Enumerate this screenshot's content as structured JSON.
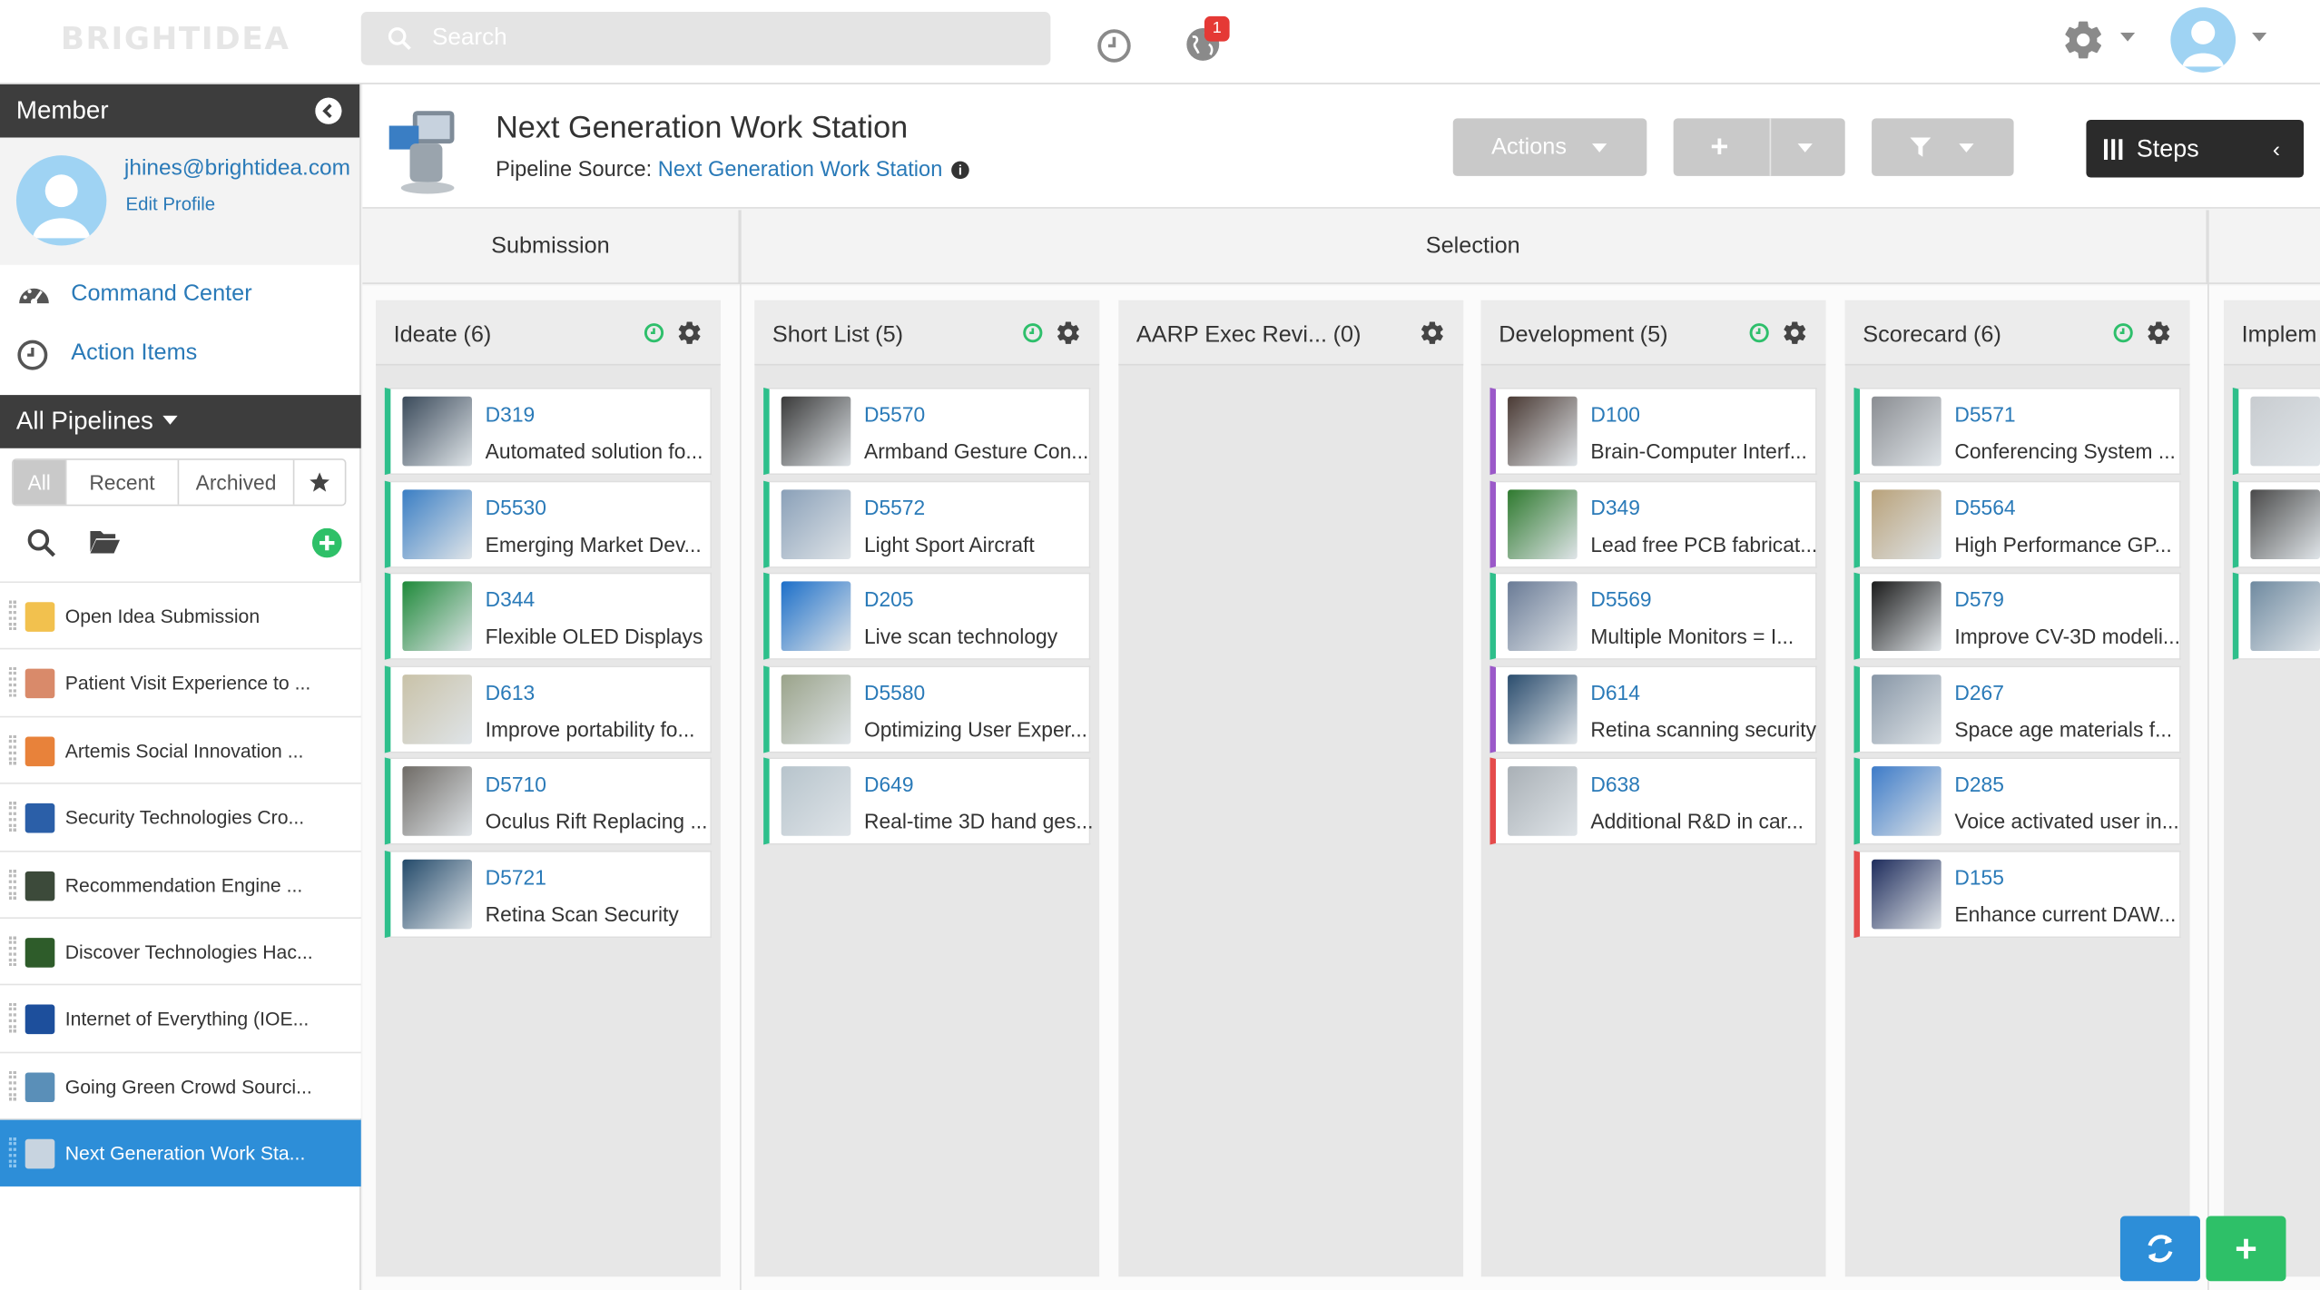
{
  "topbar": {
    "logo": "BRIGHTIDEA",
    "search_placeholder": "Search",
    "notification_count": "1"
  },
  "sidebar": {
    "member_title": "Member",
    "email": "jhines@brightidea.com",
    "edit_profile": "Edit Profile",
    "nav": [
      {
        "label": "Command Center",
        "icon": "dashboard-icon"
      },
      {
        "label": "Action Items",
        "icon": "clock-icon"
      }
    ],
    "pipelines_title": "All Pipelines",
    "filters": {
      "all": "All",
      "recent": "Recent",
      "archived": "Archived"
    },
    "pipelines": [
      {
        "label": "Open Idea Submission",
        "color": "#f2c14e"
      },
      {
        "label": "Patient Visit Experience to ...",
        "color": "#d98a6a"
      },
      {
        "label": "Artemis Social Innovation ...",
        "color": "#e8823a"
      },
      {
        "label": "Security Technologies Cro...",
        "color": "#2b5fa8"
      },
      {
        "label": "Recommendation Engine ...",
        "color": "#3c4a3a"
      },
      {
        "label": "Discover Technologies Hac...",
        "color": "#2e5c2a"
      },
      {
        "label": "Internet of Everything (IOE...",
        "color": "#1d4f9c"
      },
      {
        "label": "Going Green Crowd Sourci...",
        "color": "#5a8fb8"
      },
      {
        "label": "Next Generation Work Sta...",
        "color": "#c8d4e0",
        "active": true
      }
    ]
  },
  "header": {
    "title": "Next Generation Work Station",
    "source_label": "Pipeline Source: ",
    "source_link": "Next Generation Work Station",
    "actions_label": "Actions",
    "steps_label": "Steps"
  },
  "phases": {
    "submission": "Submission",
    "selection": "Selection"
  },
  "columns": [
    {
      "name": "Ideate",
      "count": "(6)",
      "clock": true,
      "cards": [
        {
          "id": "D319",
          "title": "Automated solution fo...",
          "color": "#2ebf8b",
          "img": "#3a4a5a"
        },
        {
          "id": "D5530",
          "title": "Emerging Market Dev...",
          "color": "#2ebf8b",
          "img": "#3a7ec4"
        },
        {
          "id": "D344",
          "title": "Flexible OLED Displays",
          "color": "#2ebf8b",
          "img": "#1f8a3a"
        },
        {
          "id": "D613",
          "title": "Improve portability fo...",
          "color": "#2ebf8b",
          "img": "#c9c2a8"
        },
        {
          "id": "D5710",
          "title": "Oculus Rift Replacing ...",
          "color": "#2ebf8b",
          "img": "#6f6b66"
        },
        {
          "id": "D5721",
          "title": "Retina Scan Security",
          "color": "#2ebf8b",
          "img": "#234a6a"
        }
      ]
    },
    {
      "name": "Short List",
      "count": "(5)",
      "clock": true,
      "cards": [
        {
          "id": "D5570",
          "title": "Armband Gesture Con...",
          "color": "#2ebf8b",
          "img": "#3a3a3a"
        },
        {
          "id": "D5572",
          "title": "Light Sport Aircraft",
          "color": "#2ebf8b",
          "img": "#8aa0b8"
        },
        {
          "id": "D205",
          "title": "Live scan technology",
          "color": "#2ebf8b",
          "img": "#1c6fc9"
        },
        {
          "id": "D5580",
          "title": "Optimizing User Exper...",
          "color": "#2ebf8b",
          "img": "#9aa38a"
        },
        {
          "id": "D649",
          "title": "Real-time 3D hand ges...",
          "color": "#2ebf8b",
          "img": "#b7c4cc"
        }
      ]
    },
    {
      "name": "AARP Exec Revi...",
      "count": "(0)",
      "clock": false,
      "cards": []
    },
    {
      "name": "Development",
      "count": "(5)",
      "clock": true,
      "cards": [
        {
          "id": "D100",
          "title": "Brain-Computer Interf...",
          "color": "#9b59c9",
          "img": "#4a3a34"
        },
        {
          "id": "D349",
          "title": "Lead free PCB fabricat...",
          "color": "#9b59c9",
          "img": "#2f7a2f"
        },
        {
          "id": "D5569",
          "title": "Multiple Monitors = I...",
          "color": "#2ebf8b",
          "img": "#6a7b96"
        },
        {
          "id": "D614",
          "title": "Retina scanning security",
          "color": "#9b59c9",
          "img": "#2b4d6e"
        },
        {
          "id": "D638",
          "title": "Additional R&D in car...",
          "color": "#e54b4b",
          "img": "#a9b0b6"
        }
      ]
    },
    {
      "name": "Scorecard",
      "count": "(6)",
      "clock": true,
      "cards": [
        {
          "id": "D5571",
          "title": "Conferencing System ...",
          "color": "#2ebf8b",
          "img": "#8a8d92"
        },
        {
          "id": "D5564",
          "title": "High Performance GP...",
          "color": "#2ebf8b",
          "img": "#b9a27a"
        },
        {
          "id": "D579",
          "title": "Improve CV-3D modeli...",
          "color": "#2ebf8b",
          "img": "#1b1b1b"
        },
        {
          "id": "D267",
          "title": "Space age materials f...",
          "color": "#2ebf8b",
          "img": "#8796a6"
        },
        {
          "id": "D285",
          "title": "Voice activated user in...",
          "color": "#2ebf8b",
          "img": "#3d7bc8"
        },
        {
          "id": "D155",
          "title": "Enhance current DAW...",
          "color": "#e54b4b",
          "img": "#1e2c5c"
        }
      ]
    },
    {
      "name": "Implem",
      "count": "",
      "clock": false,
      "cards": [
        {
          "id": "",
          "title": "",
          "color": "#2ebf8b",
          "img": "#c8ccd0"
        },
        {
          "id": "",
          "title": "",
          "color": "#2ebf8b",
          "img": "#4a4a4a"
        },
        {
          "id": "",
          "title": "",
          "color": "#2ebf8b",
          "img": "#6f8aa0"
        }
      ]
    }
  ],
  "colors": {
    "accent_blue": "#2d8ed8",
    "link_blue": "#2a7ab8",
    "green": "#2ebf8b",
    "purple": "#9b59c9",
    "red": "#e54b4b",
    "dark": "#3d3d3d"
  }
}
